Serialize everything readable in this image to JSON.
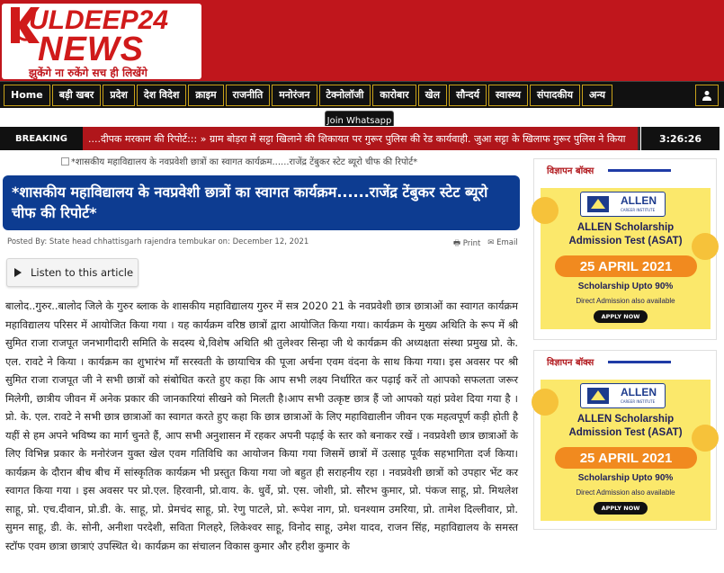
{
  "header": {
    "logo_main": "ULDEEP24",
    "logo_news": "NEWS",
    "logo_tagline": "झुकेंगे ना रुकेंगे सच ही लिखेंगे"
  },
  "nav": {
    "items": [
      "Home",
      "बड़ी खबर",
      "प्रदेश",
      "देश विदेश",
      "क्राइम",
      "राजनीति",
      "मनोरंजन",
      "टेक्नोलॉजी",
      "कारोबार",
      "खेल",
      "सौन्दर्य",
      "स्वास्थ्य",
      "संपादकीय",
      "अन्य"
    ],
    "user_icon": "user-icon"
  },
  "whatsapp_label": "Join Whatsapp",
  "breaking": {
    "label": "BREAKING",
    "ticker_text": "....दीपक मरकाम की रिपोर्ट:::  »  ग्राम बोड़रा में सट्टा खिलाने की शिकायत पर गुरूर पुलिस की रेड कार्यवाही. जुआ सट्टा के खिलाफ गुरूर पुलिस ने किया",
    "clock": "3:26:26"
  },
  "article": {
    "image_alt": "*शासकीय महाविद्यालय के नवप्रवेशी छात्रों का स्वागत कार्यक्रम......राजेंद्र टेंबुकर स्टेट ब्यूरो चीफ की रिपोर्ट*",
    "title": "*शासकीय महाविद्यालय के नवप्रवेशी छात्रों का स्वागत कार्यक्रम......राजेंद्र टेंबुकर स्टेट ब्यूरो चीफ की रिपोर्ट*",
    "posted_by": "Posted By: State head chhattisgarh rajendra tembukar   on: December 12, 2021",
    "print_label": "Print",
    "email_label": "Email",
    "listen_label": "Listen to this article",
    "body": "बालोद..गुरुर..बालोद जिले के गुरुर ब्लाक के शासकीय महाविद्यालय गुरुर में सत्र 2020 21 के नवप्रवेशी छात्र छात्राओं का स्वागत कार्यक्रम महाविद्यालय परिसर में आयोजित किया गया । यह कार्यक्रम वरिष्ठ छात्रों द्वारा आयोजित किया गया। कार्यक्रम के मुख्य अथिति के रूप में श्री सुमित राजा राजपूत जनभागीदारी समिति के सदस्य थे,विशेष अथिति श्री तुलेश्वर सिन्हा जी थे कार्यक्रम की अध्यक्षता संस्था प्रमुख प्रो. के. एल. रावटे ने किया । कार्यक्रम का शुभारंभ माँ सरस्वती के छायाचित्र की पूजा अर्चना एवम वंदना के साथ किया गया। इस अवसर पर श्री सुमित राजा राजपूत जी ने सभी छात्रों को संबोधित करते हुए कहा कि आप सभी लक्ष्य निर्धारित कर पढ़ाई करें तो आपको सफलता जरूर मिलेगी, छात्रीय जीवन में अनेक प्रकार की जानकारियां सीखने को मिलती है।आप सभी उत्कृष्ट छात्र हैं जो आपको यहां प्रवेश दिया गया है ।प्रो. के. एल. रावटे ने सभी छात्र छात्राओं का स्वागत करते हुए कहा कि छात्र छात्राओं के लिए महाविद्यालीन जीवन एक महत्वपूर्ण कड़ी होती है यहीं से हम अपने भविष्य का मार्ग चुनते हैं, आप सभी अनुशासन में रहकर अपनी पढ़ाई के स्तर को बनाकर रखें । नवप्रवेशी छात्र छात्राओं के लिए विभिन्न प्रकार के मनोरंजन युक्त खेल एवम गतिविधि का आयोजन किया गया जिसमें छात्रों में उत्साह पूर्वक सहभागिता दर्ज किया। कार्यक्रम के दौरान बीच बीच में सांस्कृतिक कार्यक्रम भी प्रस्तुत किया गया जो बहुत ही सराहनीय रहा । नवप्रवेशी छात्रों को उपहार भेंट कर स्वागत किया गया । इस अवसर पर प्रो.एल. हिरवानी, प्रो.वाय. के. धुर्वे, प्रो. एस. जोशी, प्रो. सौरभ कुमार, प्रो. पंकज साहू, प्रो. मिथलेश साहू, प्रो. एच.दीवान, प्रो.डी. के. साहू, प्रो. प्रेमचंद साहू, प्रो. रेणु पाटले, प्रो. रूपेश नाग, प्रो. घनश्याम उमरिया, प्रो. तामेश दिल्लीवार, प्रो. सुमन साहू, डी. के. सोनी, अनीशा परदेशी, सविता गिलहरे, लिकेश्वर साहू, विनोद साहू, उमेश यादव, राजन सिंह, महाविद्यालय के समस्त स्टॉफ एवम छात्रा छात्राएं उपस्थित थे। कार्यक्रम का संचालन विकास कुमार और हरीश कुमार के"
  },
  "sidebar": {
    "widgets": [
      {
        "heading": "विज्ञापन बॉक्स",
        "ad": {
          "logo": "ALLEN",
          "logo_sub": "CAREER INSTITUTE",
          "title_line1": "ALLEN Scholarship",
          "title_line2": "Admission Test (ASAT)",
          "date": "25 APRIL 2021",
          "scholarship": "Scholarship Upto 90%",
          "direct": "Direct Admission also available",
          "apply": "APPLY NOW"
        }
      },
      {
        "heading": "विज्ञापन बॉक्स",
        "ad": {
          "logo": "ALLEN",
          "logo_sub": "CAREER INSTITUTE",
          "title_line1": "ALLEN Scholarship",
          "title_line2": "Admission Test (ASAT)",
          "date": "25 APRIL 2021",
          "scholarship": "Scholarship Upto 90%",
          "direct": "Direct Admission also available",
          "apply": "APPLY NOW"
        }
      }
    ]
  },
  "colors": {
    "brand_red": "#c0161c",
    "title_blue": "#0d3c91",
    "nav_black": "#111111",
    "ad_yellow": "#fbe86b",
    "ad_orange": "#f18a1f"
  }
}
